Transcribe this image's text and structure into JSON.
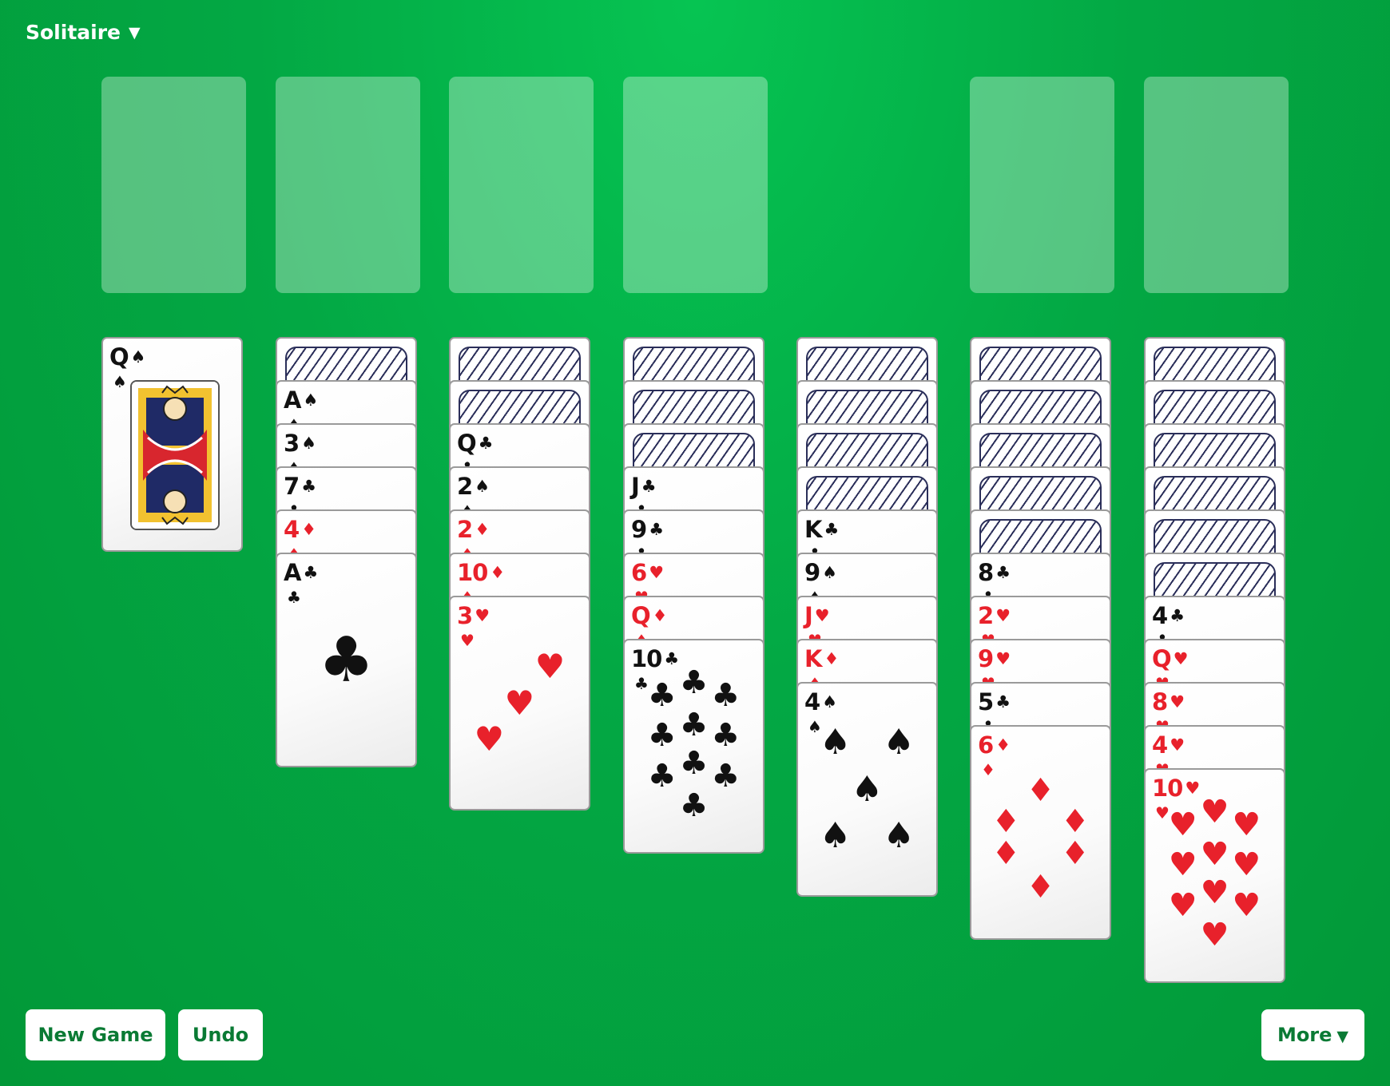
{
  "app": {
    "title": "Solitaire",
    "menu_caret": "▼"
  },
  "toolbar": {
    "new_game_label": "New Game",
    "undo_label": "Undo",
    "more_label": "More",
    "more_caret": "▼"
  },
  "colors": {
    "felt": "#03a844",
    "button_text": "#0a7a34",
    "red_suit": "#e8212b",
    "card_back_pattern": "#2b2f5a"
  },
  "top_row": {
    "stock": "empty",
    "waste": "empty",
    "foundations": [
      "empty",
      "empty",
      "empty",
      "empty"
    ]
  },
  "tableau": [
    {
      "face_down": 0,
      "face_up": [
        {
          "rank": "Q",
          "suit": "♠"
        }
      ]
    },
    {
      "face_down": 1,
      "face_up": [
        {
          "rank": "A",
          "suit": "♠"
        },
        {
          "rank": "3",
          "suit": "♠"
        },
        {
          "rank": "7",
          "suit": "♣"
        },
        {
          "rank": "4",
          "suit": "♦"
        },
        {
          "rank": "A",
          "suit": "♣"
        }
      ]
    },
    {
      "face_down": 2,
      "face_up": [
        {
          "rank": "Q",
          "suit": "♣"
        },
        {
          "rank": "2",
          "suit": "♠"
        },
        {
          "rank": "2",
          "suit": "♦"
        },
        {
          "rank": "10",
          "suit": "♦"
        },
        {
          "rank": "3",
          "suit": "♥"
        }
      ]
    },
    {
      "face_down": 3,
      "face_up": [
        {
          "rank": "J",
          "suit": "♣"
        },
        {
          "rank": "9",
          "suit": "♣"
        },
        {
          "rank": "6",
          "suit": "♥"
        },
        {
          "rank": "Q",
          "suit": "♦"
        },
        {
          "rank": "10",
          "suit": "♣"
        }
      ]
    },
    {
      "face_down": 4,
      "face_up": [
        {
          "rank": "K",
          "suit": "♣"
        },
        {
          "rank": "9",
          "suit": "♠"
        },
        {
          "rank": "J",
          "suit": "♥"
        },
        {
          "rank": "K",
          "suit": "♦"
        },
        {
          "rank": "4",
          "suit": "♠"
        }
      ]
    },
    {
      "face_down": 5,
      "face_up": [
        {
          "rank": "8",
          "suit": "♣"
        },
        {
          "rank": "2",
          "suit": "♥"
        },
        {
          "rank": "9",
          "suit": "♥"
        },
        {
          "rank": "5",
          "suit": "♣"
        },
        {
          "rank": "6",
          "suit": "♦"
        }
      ]
    },
    {
      "face_down": 6,
      "face_up": [
        {
          "rank": "4",
          "suit": "♣"
        },
        {
          "rank": "Q",
          "suit": "♥"
        },
        {
          "rank": "8",
          "suit": "♥"
        },
        {
          "rank": "4",
          "suit": "♥"
        },
        {
          "rank": "10",
          "suit": "♥"
        }
      ]
    }
  ]
}
